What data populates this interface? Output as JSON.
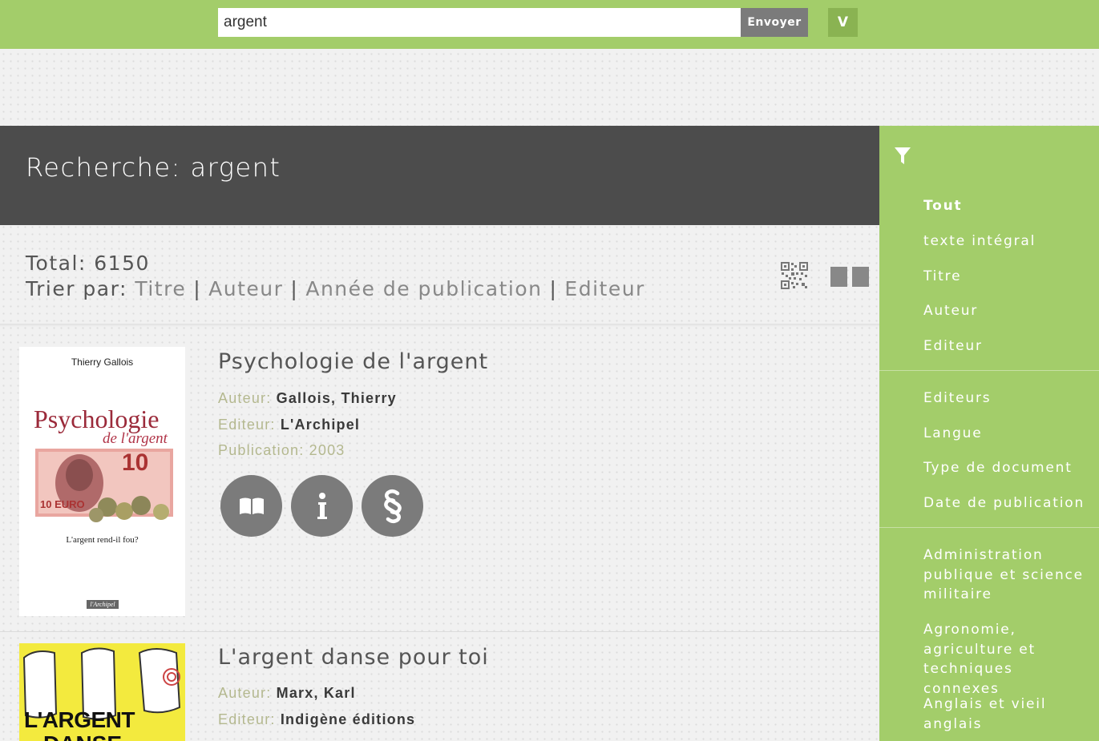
{
  "search": {
    "value": "argent",
    "button_label": "Envoyer",
    "toggle_label": "V"
  },
  "header": {
    "title": "Recherche: argent"
  },
  "results_meta": {
    "total": "Total: 6150",
    "sort_label": "Trier par:",
    "sort_options": [
      "Titre",
      "Auteur",
      "Année de publication",
      "Editeur"
    ],
    "separator": "|"
  },
  "results": [
    {
      "title": "Psychologie de l'argent",
      "author_label": "Auteur:",
      "author": "Gallois, Thierry",
      "publisher_label": "Editeur:",
      "publisher": "L'Archipel",
      "publication": "Publication: 2003",
      "cover": {
        "author": "Thierry Gallois",
        "title_line1": "Psychologie",
        "title_line2": "de l'argent",
        "tagline": "L'argent rend-il fou?",
        "banknote": "10",
        "euro": "10 EURO",
        "publisher": "l'Archipel"
      }
    },
    {
      "title": "L'argent danse pour toi",
      "author_label": "Auteur:",
      "author": "Marx, Karl",
      "publisher_label": "Editeur:",
      "publisher": "Indigène éditions",
      "cover": {
        "title_line1": "L'ARGENT",
        "title_line2": "DANSE"
      }
    }
  ],
  "sidebar": {
    "group1": [
      "Tout",
      "texte intégral",
      "Titre",
      "Auteur",
      "Editeur"
    ],
    "group2": [
      "Editeurs",
      "Langue",
      "Type de document",
      "Date de publication"
    ],
    "group3": [
      "Administration publique et science militaire",
      "Agronomie, agriculture et techniques connexes",
      "Anglais et vieil anglais"
    ]
  },
  "colors": {
    "green": "#a3cd6a",
    "dark_band": "#4c4c4c",
    "button_grey": "#7b7b7b"
  }
}
